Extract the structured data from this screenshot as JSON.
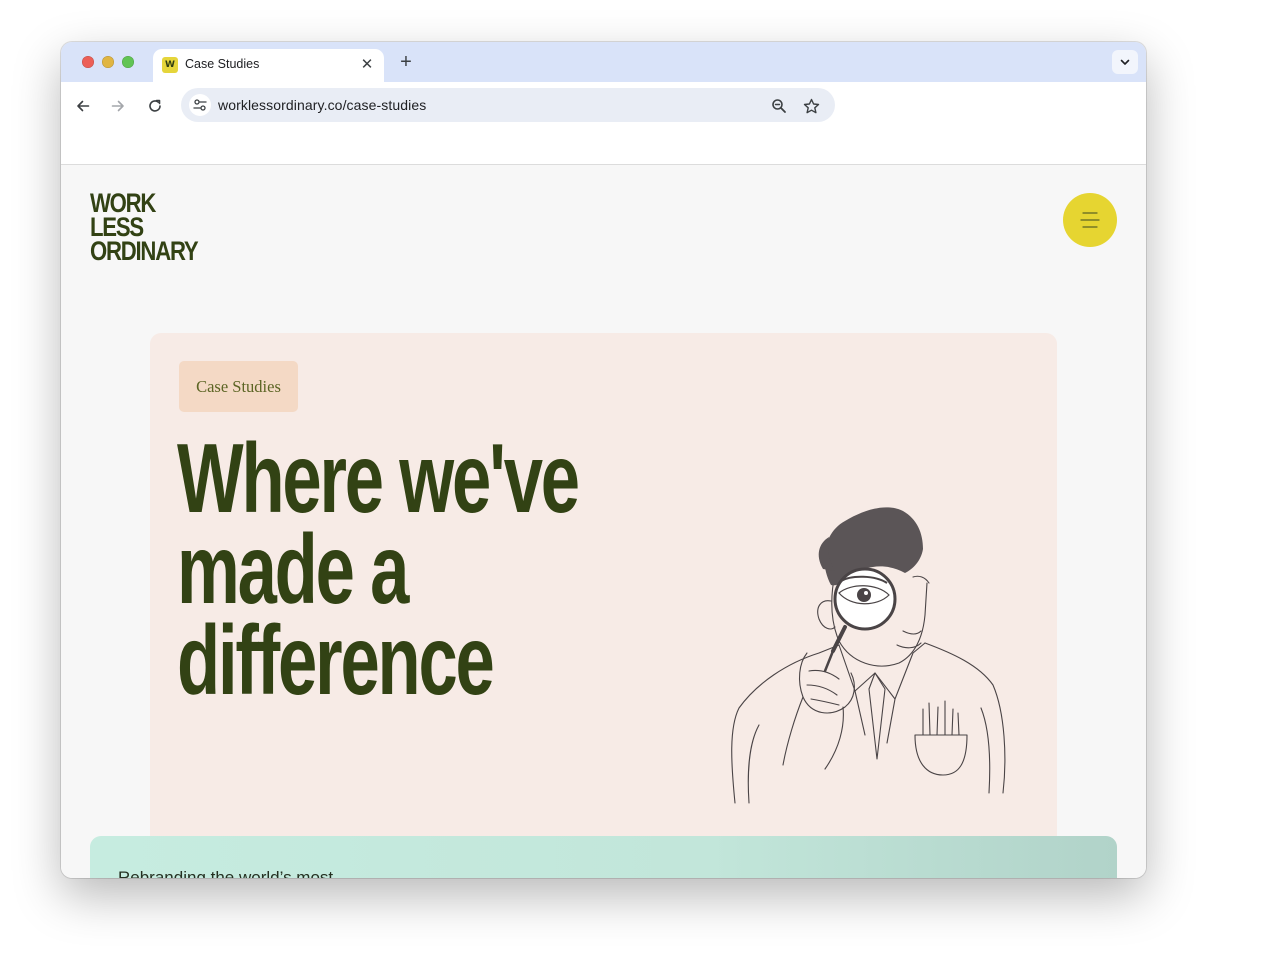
{
  "browser": {
    "tab": {
      "favicon_letter": "W",
      "title": "Case Studies"
    },
    "url": "worklessordinary.co/case-studies"
  },
  "site": {
    "logo_lines": [
      "WORK",
      "LESS",
      "ORDINARY"
    ],
    "menu_icon": "hamburger-icon"
  },
  "hero": {
    "badge": "Case Studies",
    "headline_lines": [
      "Where we've",
      "made a",
      "difference"
    ],
    "illustration": "man-with-magnifying-glass"
  },
  "case_card": {
    "title": "Rebranding the world’s most"
  },
  "colors": {
    "brand_green": "#324214",
    "brand_yellow": "#e6d531",
    "hero_bg": "#f7ebe6",
    "badge_bg": "#f4d9c5",
    "card_mint": "#c6ece0"
  }
}
